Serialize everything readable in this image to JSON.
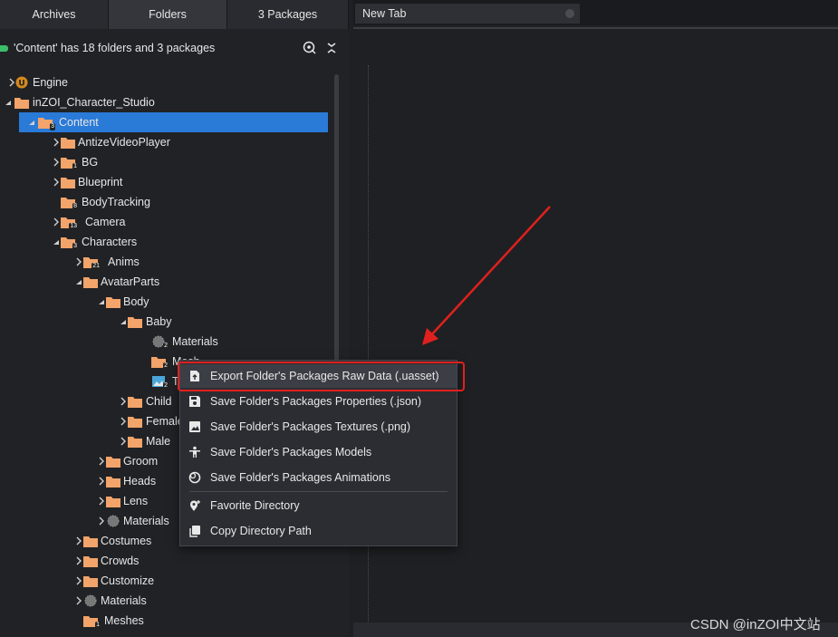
{
  "tabs": [
    {
      "label": "Archives"
    },
    {
      "label": "Folders"
    },
    {
      "label": "3 Packages"
    }
  ],
  "status": {
    "text": "'Content' has 18 folders and 3 packages",
    "color": "#3bbf6a"
  },
  "tree": [
    {
      "label": "Engine",
      "icon": "unreal-engine-icon"
    },
    {
      "label": "inZOI_Character_Studio",
      "icon": "folder-icon"
    },
    {
      "label": "Content",
      "icon": "folder-icon",
      "badge": "3",
      "selected": true
    },
    {
      "label": "AntizeVideoPlayer",
      "icon": "folder-icon"
    },
    {
      "label": "BG",
      "icon": "folder-icon",
      "badge": "1"
    },
    {
      "label": "Blueprint",
      "icon": "folder-icon"
    },
    {
      "label": "BodyTracking",
      "icon": "folder-icon",
      "badge": "8"
    },
    {
      "label": "Camera",
      "icon": "folder-icon",
      "badge": "13"
    },
    {
      "label": "Characters",
      "icon": "folder-icon",
      "badge": "3"
    },
    {
      "label": "Anims",
      "icon": "folder-icon",
      "badge": "21"
    },
    {
      "label": "AvatarParts",
      "icon": "folder-icon"
    },
    {
      "label": "Body",
      "icon": "folder-icon"
    },
    {
      "label": "Baby",
      "icon": "folder-icon"
    },
    {
      "label": "Materials",
      "icon": "material-icon",
      "badge": "2"
    },
    {
      "label": "Mesh",
      "icon": "folder-icon",
      "badge": "2"
    },
    {
      "label": "T",
      "icon": "texture-icon",
      "badge": "2"
    },
    {
      "label": "Child",
      "icon": "folder-icon"
    },
    {
      "label": "Female",
      "icon": "folder-icon"
    },
    {
      "label": "Male",
      "icon": "folder-icon"
    },
    {
      "label": "Groom",
      "icon": "folder-icon"
    },
    {
      "label": "Heads",
      "icon": "folder-icon"
    },
    {
      "label": "Lens",
      "icon": "folder-icon"
    },
    {
      "label": "Materials",
      "icon": "material-icon"
    },
    {
      "label": "Costumes",
      "icon": "folder-icon"
    },
    {
      "label": "Crowds",
      "icon": "folder-icon"
    },
    {
      "label": "Customize",
      "icon": "folder-icon"
    },
    {
      "label": "Materials",
      "icon": "material-icon"
    },
    {
      "label": "Meshes",
      "icon": "folder-icon",
      "badge": "1"
    }
  ],
  "main": {
    "tab_label": "New Tab"
  },
  "context_menu": {
    "items": [
      {
        "label": "Export Folder's Packages Raw Data (.uasset)",
        "icon": "export-file-icon"
      },
      {
        "label": "Save Folder's Packages Properties (.json)",
        "icon": "save-icon"
      },
      {
        "label": "Save Folder's Packages Textures (.png)",
        "icon": "image-icon"
      },
      {
        "label": "Save Folder's Packages Models",
        "icon": "person-model-icon"
      },
      {
        "label": "Save Folder's Packages Animations",
        "icon": "animation-icon"
      },
      {
        "label": "Favorite Directory",
        "icon": "favorite-pin-icon"
      },
      {
        "label": "Copy Directory Path",
        "icon": "copy-icon"
      }
    ]
  },
  "watermark": "CSDN @inZOI中文站",
  "colors": {
    "selection": "#2a7ad8",
    "folder": "#f2a46a",
    "highlight_border": "#e0201e",
    "arrow": "#e0201e"
  }
}
